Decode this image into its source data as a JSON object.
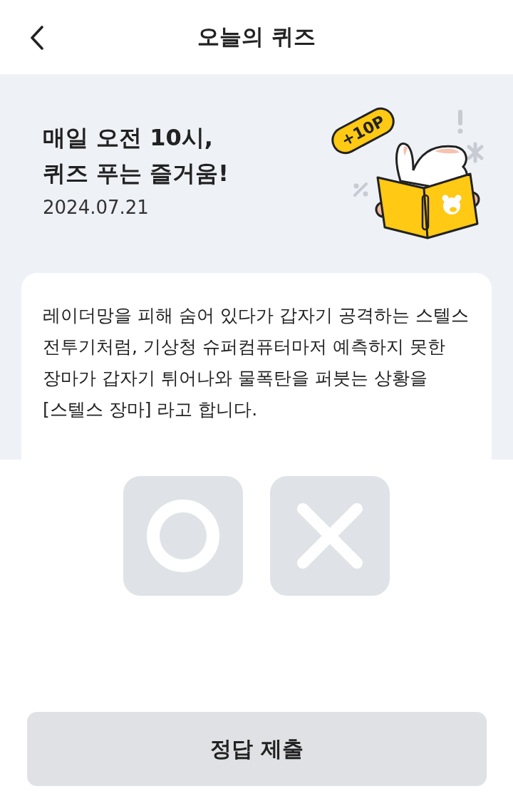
{
  "header": {
    "title": "오늘의 퀴즈"
  },
  "banner": {
    "headline": [
      "매일 오전 10시,",
      "퀴즈 푸는 즐거움!"
    ],
    "date": "2024.07.21",
    "badge": "+10P"
  },
  "question": "레이더망을 피해 숨어 있다가 갑자기 공격하는 스텔스 전투기처럼, 기상청 슈퍼컴퓨터마저 예측하지 못한 장마가 갑자기 튀어나와 물폭탄을 퍼붓는 상황을 [스텔스 장마] 라고 합니다.",
  "answers": [
    {
      "kind": "o",
      "selected": false
    },
    {
      "kind": "x",
      "selected": false
    }
  ],
  "submit": {
    "label": "정답 제출",
    "disabled": true
  }
}
